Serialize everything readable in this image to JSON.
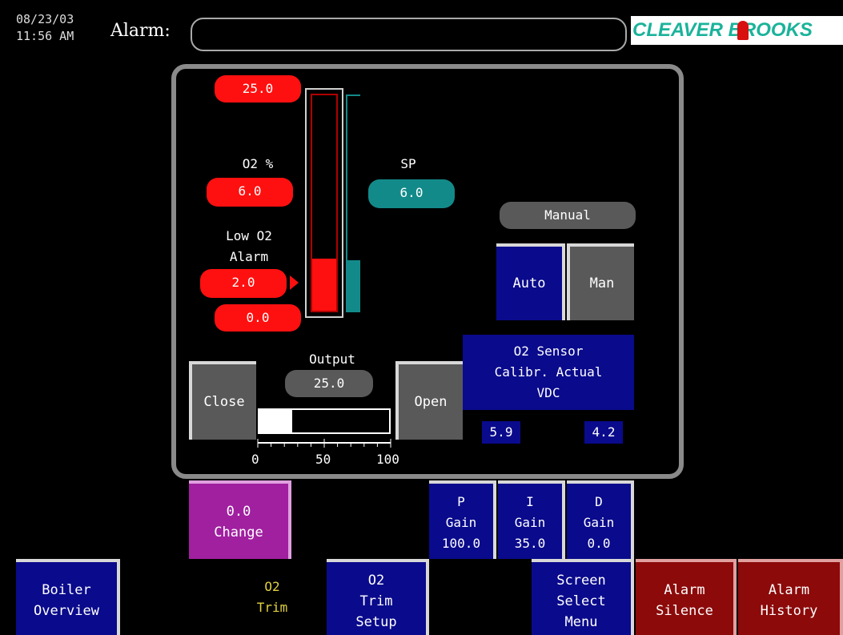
{
  "header": {
    "date": "08/23/03",
    "time": "11:56 AM",
    "alarm_label": "Alarm:",
    "alarm_text": "",
    "logo": "CLEAVER BROOKS"
  },
  "o2_gauge": {
    "max": "25.0",
    "o2_label": "O2 %",
    "o2_value": "6.0",
    "low_alarm_label_1": "Low O2",
    "low_alarm_label_2": "Alarm",
    "low_alarm_value": "2.0",
    "min": "0.0",
    "o2_fill_fraction": 0.24,
    "sp_fill_fraction": 0.24
  },
  "setpoint": {
    "label": "SP",
    "value": "6.0"
  },
  "mode": {
    "status": "Manual",
    "auto_label": "Auto",
    "man_label": "Man"
  },
  "output": {
    "label": "Output",
    "value": "25.0",
    "close_label": "Close",
    "open_label": "Open",
    "fill_percent": 25,
    "scale": [
      "0",
      "50",
      "100"
    ]
  },
  "sensor": {
    "title_1": "O2 Sensor",
    "title_2": "Calibr. Actual",
    "title_3": "VDC",
    "calibr_value": "5.9",
    "actual_value": "4.2"
  },
  "change": {
    "value": "0.0",
    "label": "Change"
  },
  "gains": {
    "p": {
      "l1": "P",
      "l2": "Gain",
      "value": "100.0"
    },
    "i": {
      "l1": "I",
      "l2": "Gain",
      "value": "35.0"
    },
    "d": {
      "l1": "D",
      "l2": "Gain",
      "value": "0.0"
    }
  },
  "nav": {
    "boiler_1": "Boiler",
    "boiler_2": "Overview",
    "o2trim_1": "O2",
    "o2trim_2": "Trim",
    "setup_1": "O2",
    "setup_2": "Trim",
    "setup_3": "Setup",
    "screen_1": "Screen",
    "screen_2": "Select",
    "screen_3": "Menu",
    "silence_1": "Alarm",
    "silence_2": "Silence",
    "history_1": "Alarm",
    "history_2": "History"
  },
  "colors": {
    "red": "#ff1010",
    "teal": "#138a8a",
    "blue": "#0a0a8c",
    "purple": "#a020a0",
    "darkred": "#8c0a0a",
    "logo_teal": "#1ab39a"
  }
}
